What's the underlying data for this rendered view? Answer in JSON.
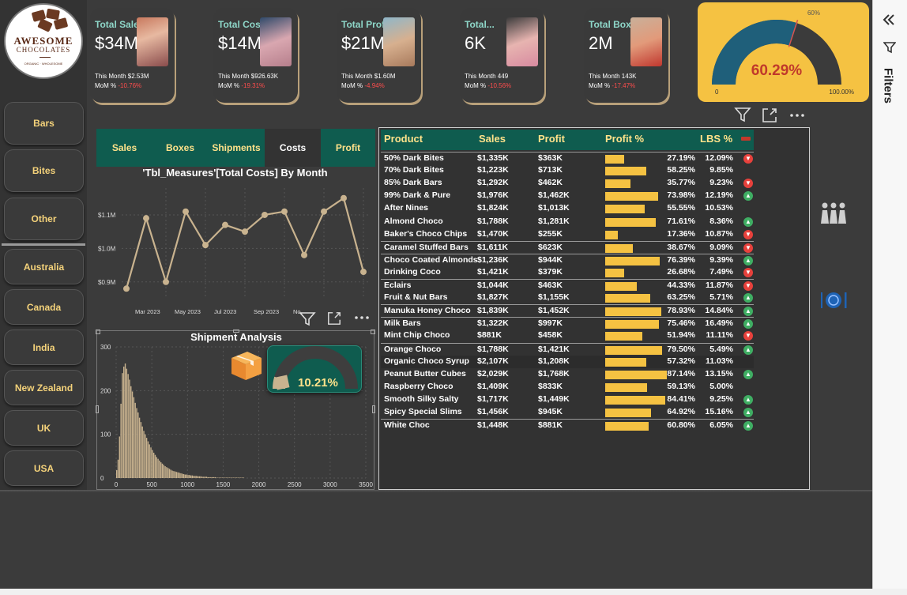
{
  "brand": {
    "name_line1": "AWESOME",
    "name_line2": "CHOCOLATES",
    "tagline": "ORGANIC · WHOLESOME"
  },
  "sidebar": {
    "categories": [
      "Bars",
      "Bites",
      "Other"
    ],
    "countries": [
      "Australia",
      "Canada",
      "India",
      "New Zealand",
      "UK",
      "USA"
    ]
  },
  "kpis": [
    {
      "title": "Total Sales",
      "value": "$34M",
      "month": "This Month $2.53M",
      "mom_label": "MoM %",
      "mom": "-10.76%"
    },
    {
      "title": "Total Costs",
      "value": "$14M",
      "month": "This Month $926.63K",
      "mom_label": "MoM %",
      "mom": "-19.31%"
    },
    {
      "title": "Total Profit",
      "value": "$21M",
      "month": "This Month $1.60M",
      "mom_label": "MoM %",
      "mom": "-4.94%"
    },
    {
      "title": "Total...",
      "value": "6K",
      "month": "This Month 449",
      "mom_label": "MoM %",
      "mom": "-10.56%"
    },
    {
      "title": "Total Boxes",
      "value": "2M",
      "month": "This Month 143K",
      "mom_label": "MoM %",
      "mom": "-17.47%"
    }
  ],
  "profit_gauge": {
    "value": 60.29,
    "value_label": "60.29%",
    "target_label": "60%",
    "min_label": "0",
    "max_label": "100.00%",
    "colors": {
      "fill": "#1f5f7a",
      "track": "#3b3b3b",
      "background": "#f5c242",
      "text": "#c0392b"
    }
  },
  "tabs": [
    "Sales",
    "Boxes",
    "Shipments",
    "Costs",
    "Profit"
  ],
  "active_tab": "Costs",
  "line_chart_title": "'Tbl_Measures'[Total Costs] By Month",
  "ship_title": "Shipment Analysis",
  "ship_gauge_label": "10.21%",
  "table": {
    "headers": [
      "Product",
      "Sales",
      "Profit",
      "Profit %",
      "LBS %"
    ],
    "rows": [
      {
        "product": "50% Dark Bites",
        "sales": "$1,335K",
        "profit": "$363K",
        "pct": 27.19,
        "pct_label": "27.19%",
        "lbs": "12.09%",
        "trend": "down"
      },
      {
        "product": "70% Dark Bites",
        "sales": "$1,223K",
        "profit": "$713K",
        "pct": 58.25,
        "pct_label": "58.25%",
        "lbs": "9.85%",
        "trend": ""
      },
      {
        "product": "85% Dark Bars",
        "sales": "$1,292K",
        "profit": "$462K",
        "pct": 35.77,
        "pct_label": "35.77%",
        "lbs": "9.23%",
        "trend": "down"
      },
      {
        "product": "99% Dark & Pure",
        "sales": "$1,976K",
        "profit": "$1,462K",
        "pct": 73.98,
        "pct_label": "73.98%",
        "lbs": "12.19%",
        "trend": "up"
      },
      {
        "product": "After Nines",
        "sales": "$1,824K",
        "profit": "$1,013K",
        "pct": 55.55,
        "pct_label": "55.55%",
        "lbs": "10.53%",
        "trend": ""
      },
      {
        "product": "Almond Choco",
        "sales": "$1,788K",
        "profit": "$1,281K",
        "pct": 71.61,
        "pct_label": "71.61%",
        "lbs": "8.36%",
        "trend": "up"
      },
      {
        "product": "Baker's Choco Chips",
        "sales": "$1,470K",
        "profit": "$255K",
        "pct": 17.36,
        "pct_label": "17.36%",
        "lbs": "10.87%",
        "trend": "down"
      },
      {
        "product": "Caramel Stuffed Bars",
        "sales": "$1,611K",
        "profit": "$623K",
        "pct": 38.67,
        "pct_label": "38.67%",
        "lbs": "9.09%",
        "trend": "down"
      },
      {
        "product": "Choco Coated Almonds",
        "sales": "$1,236K",
        "profit": "$944K",
        "pct": 76.39,
        "pct_label": "76.39%",
        "lbs": "9.39%",
        "trend": "up"
      },
      {
        "product": "Drinking Coco",
        "sales": "$1,421K",
        "profit": "$379K",
        "pct": 26.68,
        "pct_label": "26.68%",
        "lbs": "7.49%",
        "trend": "down"
      },
      {
        "product": "Eclairs",
        "sales": "$1,044K",
        "profit": "$463K",
        "pct": 44.33,
        "pct_label": "44.33%",
        "lbs": "11.87%",
        "trend": "down"
      },
      {
        "product": "Fruit & Nut Bars",
        "sales": "$1,827K",
        "profit": "$1,155K",
        "pct": 63.25,
        "pct_label": "63.25%",
        "lbs": "5.71%",
        "trend": "up"
      },
      {
        "product": "Manuka Honey Choco",
        "sales": "$1,839K",
        "profit": "$1,452K",
        "pct": 78.93,
        "pct_label": "78.93%",
        "lbs": "14.84%",
        "trend": "up"
      },
      {
        "product": "Milk Bars",
        "sales": "$1,322K",
        "profit": "$997K",
        "pct": 75.46,
        "pct_label": "75.46%",
        "lbs": "16.49%",
        "trend": "up"
      },
      {
        "product": "Mint Chip Choco",
        "sales": "$881K",
        "profit": "$458K",
        "pct": 51.94,
        "pct_label": "51.94%",
        "lbs": "11.11%",
        "trend": "down"
      },
      {
        "product": "Orange Choco",
        "sales": "$1,788K",
        "profit": "$1,421K",
        "pct": 79.5,
        "pct_label": "79.50%",
        "lbs": "5.49%",
        "trend": "up"
      },
      {
        "product": "Organic Choco Syrup",
        "sales": "$2,107K",
        "profit": "$1,208K",
        "pct": 57.32,
        "pct_label": "57.32%",
        "lbs": "11.03%",
        "trend": ""
      },
      {
        "product": "Peanut Butter Cubes",
        "sales": "$2,029K",
        "profit": "$1,768K",
        "pct": 87.14,
        "pct_label": "87.14%",
        "lbs": "13.15%",
        "trend": "up"
      },
      {
        "product": "Raspberry Choco",
        "sales": "$1,409K",
        "profit": "$833K",
        "pct": 59.13,
        "pct_label": "59.13%",
        "lbs": "5.00%",
        "trend": ""
      },
      {
        "product": "Smooth Silky Salty",
        "sales": "$1,717K",
        "profit": "$1,449K",
        "pct": 84.41,
        "pct_label": "84.41%",
        "lbs": "9.25%",
        "trend": "up"
      },
      {
        "product": "Spicy Special Slims",
        "sales": "$1,456K",
        "profit": "$945K",
        "pct": 64.92,
        "pct_label": "64.92%",
        "lbs": "15.16%",
        "trend": "up"
      },
      {
        "product": "White Choc",
        "sales": "$1,448K",
        "profit": "$881K",
        "pct": 60.8,
        "pct_label": "60.80%",
        "lbs": "6.05%",
        "trend": "up"
      }
    ]
  },
  "filters_label": "Filters",
  "chart_data": [
    {
      "type": "line",
      "title": "'Tbl_Measures'[Total Costs] By Month",
      "x": [
        "Feb 2023",
        "Mar 2023",
        "Apr 2023",
        "May 2023",
        "Jun 2023",
        "Jul 2023",
        "Aug 2023",
        "Sep 2023",
        "Oct 2023",
        "Nov 2023",
        "Dec 2023",
        "Jan 2024",
        "Feb 2024"
      ],
      "x_tick_labels": [
        "Mar 2023",
        "May 2023",
        "Jul 2023",
        "Sep 2023",
        "No"
      ],
      "y": [
        0.88,
        1.09,
        0.9,
        1.11,
        1.01,
        1.07,
        1.05,
        1.1,
        1.11,
        0.98,
        1.11,
        1.15,
        0.93
      ],
      "y_ticks": [
        "$0.9M",
        "$1.0M",
        "$1.1M"
      ],
      "ylim": [
        0.85,
        1.18
      ],
      "color": "#c9b38f",
      "grid": true
    },
    {
      "type": "bar",
      "title": "Shipment Analysis",
      "x_ticks": [
        "0",
        "500",
        "1000",
        "1500",
        "2000",
        "2500",
        "3000",
        "3500"
      ],
      "y_ticks": [
        "0",
        "100",
        "200",
        "300"
      ],
      "xlim": [
        0,
        3500
      ],
      "ylim": [
        0,
        300
      ],
      "bin_width": 20,
      "values": [
        18,
        42,
        95,
        170,
        240,
        255,
        262,
        250,
        238,
        225,
        210,
        198,
        185,
        172,
        160,
        150,
        138,
        128,
        118,
        108,
        100,
        92,
        84,
        77,
        70,
        64,
        58,
        53,
        48,
        44,
        40,
        36,
        33,
        30,
        27,
        25,
        23,
        21,
        19,
        17,
        16,
        15,
        14,
        13,
        12,
        11,
        10,
        9,
        8,
        8,
        7,
        7,
        6,
        6,
        5,
        5,
        5,
        4,
        4,
        4,
        3,
        3,
        3,
        3,
        2,
        2,
        2,
        2,
        2,
        2,
        1,
        1,
        1,
        1,
        1,
        1,
        1,
        1,
        1,
        1,
        1,
        1,
        1,
        1,
        1,
        1,
        1,
        1,
        1,
        1
      ],
      "color": "#c9b38f"
    },
    {
      "type": "gauge",
      "title": "Profit %",
      "value": 60.29,
      "target": 60,
      "min": 0,
      "max": 100
    }
  ]
}
